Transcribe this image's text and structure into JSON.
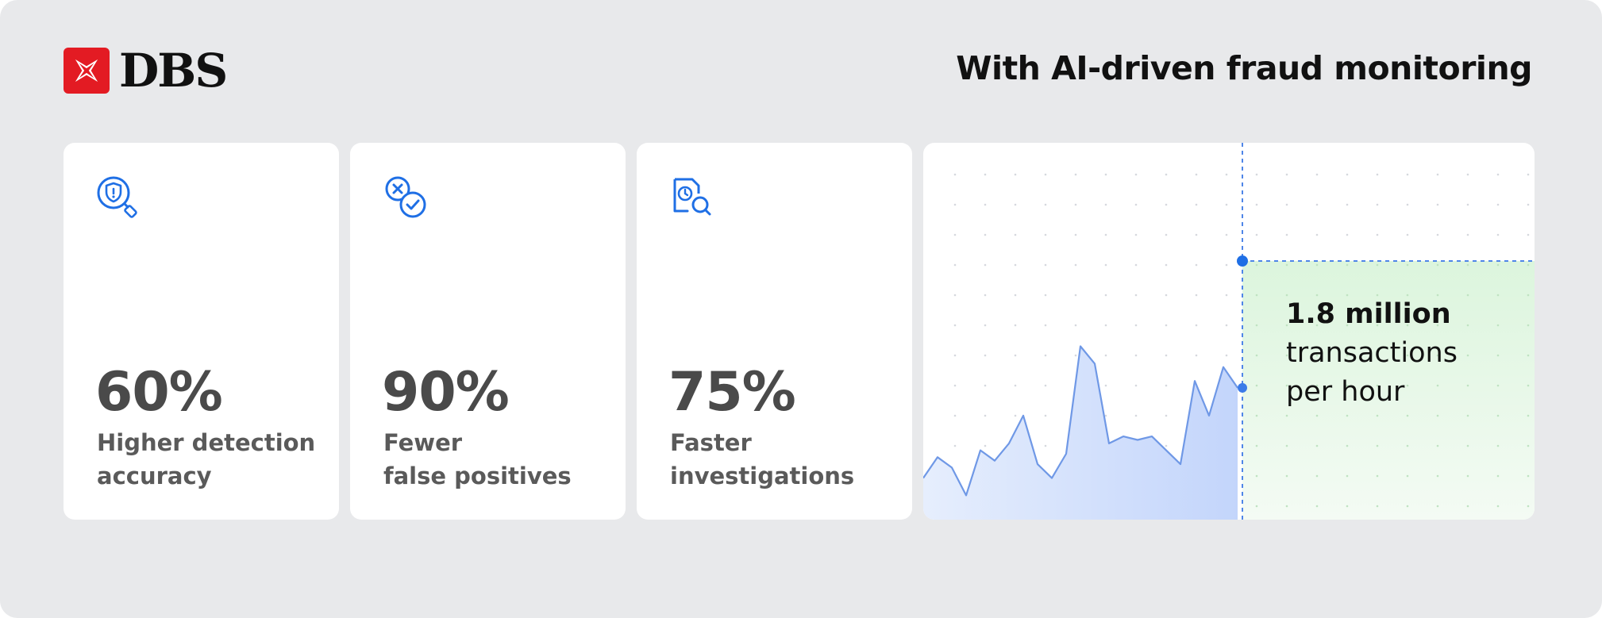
{
  "brand": {
    "name": "DBS",
    "logo_icon": "dbs-star-logo-icon",
    "color": "#e31b23"
  },
  "headline": "With AI-driven fraud monitoring",
  "cards": [
    {
      "icon": "shield-search-icon",
      "value": "60%",
      "label_lines": [
        "Higher detection",
        "accuracy"
      ]
    },
    {
      "icon": "cross-check-icon",
      "value": "90%",
      "label_lines": [
        "Fewer",
        "false positives"
      ]
    },
    {
      "icon": "document-clock-search-icon",
      "value": "75%",
      "label_lines": [
        "Faster",
        "investigations"
      ]
    }
  ],
  "metric": {
    "value": "1.8 million",
    "lines": [
      "transactions",
      "per hour"
    ]
  },
  "colors": {
    "background": "#e8e9eb",
    "accent_blue": "#1f6fe5",
    "area_blue": "#c9d9fb",
    "highlight_green": "#dff5e0",
    "text_dark": "#111111",
    "text_gray": "#4a4a4a"
  },
  "chart_data": {
    "type": "area",
    "title": "",
    "xlabel": "",
    "ylabel": "",
    "grid": true,
    "x": [
      0,
      1,
      2,
      3,
      4,
      5,
      6,
      7,
      8,
      9,
      10,
      11,
      12,
      13,
      14,
      15,
      16,
      17,
      18,
      19,
      20,
      21,
      22
    ],
    "values": [
      12,
      18,
      15,
      7,
      20,
      17,
      22,
      30,
      16,
      12,
      19,
      50,
      45,
      22,
      24,
      23,
      24,
      20,
      16,
      40,
      30,
      44,
      38
    ],
    "ylim": [
      0,
      100
    ]
  }
}
